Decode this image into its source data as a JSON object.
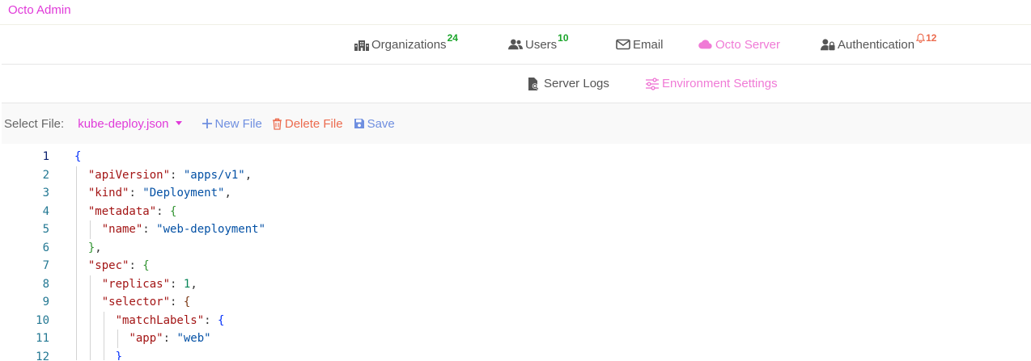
{
  "app": {
    "title": "Octo Admin"
  },
  "nav": {
    "organizations": {
      "label": "Organizations",
      "count": "24"
    },
    "users": {
      "label": "Users",
      "count": "10"
    },
    "email": {
      "label": "Email"
    },
    "octo_server": {
      "label": "Octo Server",
      "active": true
    },
    "authentication": {
      "label": "Authentication",
      "alert_count": "12"
    },
    "server_logs": {
      "label": "Server Logs"
    },
    "environment_settings": {
      "label": "Environment Settings",
      "active": true
    }
  },
  "toolbar": {
    "select_label": "Select File:",
    "selected_file": "kube-deploy.json",
    "new_file": "New File",
    "delete_file": "Delete File",
    "save": "Save"
  },
  "colors": {
    "brand": "#e03ad9",
    "active_tab": "#f07ad6",
    "count_badge": "#1aa52a",
    "alert": "#ec6b4e",
    "toolbar_action": "#6f8fe0"
  },
  "editor": {
    "current_line": 1,
    "lines": [
      {
        "num": "1",
        "tokens": [
          [
            "b1",
            "{"
          ]
        ]
      },
      {
        "num": "2",
        "tokens": [
          [
            "",
            "  "
          ],
          [
            "k",
            "\"apiVersion\""
          ],
          [
            "",
            ": "
          ],
          [
            "s",
            "\"apps/v1\""
          ],
          [
            "",
            ","
          ]
        ]
      },
      {
        "num": "3",
        "tokens": [
          [
            "",
            "  "
          ],
          [
            "k",
            "\"kind\""
          ],
          [
            "",
            ": "
          ],
          [
            "s",
            "\"Deployment\""
          ],
          [
            "",
            ","
          ]
        ]
      },
      {
        "num": "4",
        "tokens": [
          [
            "",
            "  "
          ],
          [
            "k",
            "\"metadata\""
          ],
          [
            "",
            ": "
          ],
          [
            "b2",
            "{"
          ]
        ]
      },
      {
        "num": "5",
        "tokens": [
          [
            "",
            "    "
          ],
          [
            "k",
            "\"name\""
          ],
          [
            "",
            ": "
          ],
          [
            "s",
            "\"web-deployment\""
          ]
        ]
      },
      {
        "num": "6",
        "tokens": [
          [
            "",
            "  "
          ],
          [
            "b2",
            "}"
          ],
          [
            "",
            ","
          ]
        ]
      },
      {
        "num": "7",
        "tokens": [
          [
            "",
            "  "
          ],
          [
            "k",
            "\"spec\""
          ],
          [
            "",
            ": "
          ],
          [
            "b2",
            "{"
          ]
        ]
      },
      {
        "num": "8",
        "tokens": [
          [
            "",
            "    "
          ],
          [
            "k",
            "\"replicas\""
          ],
          [
            "",
            ": "
          ],
          [
            "n",
            "1"
          ],
          [
            "",
            ","
          ]
        ]
      },
      {
        "num": "9",
        "tokens": [
          [
            "",
            "    "
          ],
          [
            "k",
            "\"selector\""
          ],
          [
            "",
            ": "
          ],
          [
            "b3",
            "{"
          ]
        ]
      },
      {
        "num": "10",
        "tokens": [
          [
            "",
            "      "
          ],
          [
            "k",
            "\"matchLabels\""
          ],
          [
            "",
            ": "
          ],
          [
            "b1",
            "{"
          ]
        ]
      },
      {
        "num": "11",
        "tokens": [
          [
            "",
            "        "
          ],
          [
            "k",
            "\"app\""
          ],
          [
            "",
            ": "
          ],
          [
            "s",
            "\"web\""
          ]
        ]
      },
      {
        "num": "12",
        "tokens": [
          [
            "",
            "      "
          ],
          [
            "b1",
            "}"
          ]
        ]
      }
    ]
  }
}
